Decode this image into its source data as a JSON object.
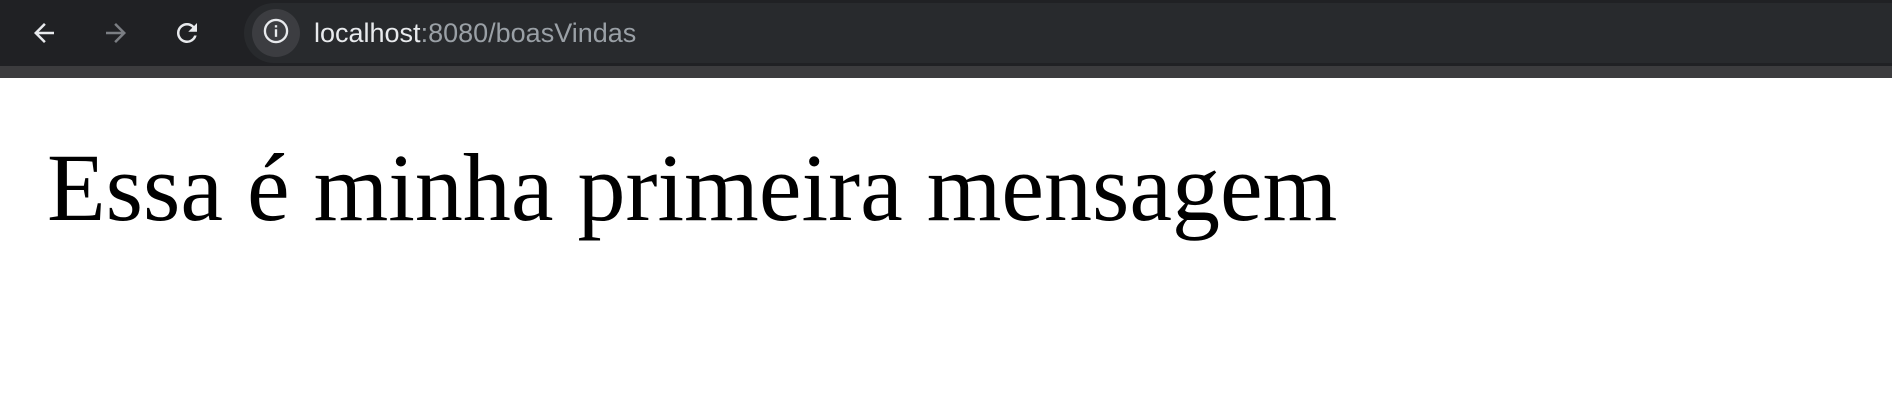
{
  "browser": {
    "address_bar": {
      "host": "localhost",
      "rest": ":8080/boasVindas"
    },
    "icons": {
      "back": "arrow-left-icon",
      "forward": "arrow-right-icon",
      "reload": "reload-icon",
      "site_info": "info-icon"
    },
    "forward_enabled": false
  },
  "page": {
    "heading": "Essa é minha primeira mensagem"
  },
  "colors": {
    "toolbar_bg": "#202124",
    "omnibox_bg": "#282a2d",
    "url_host": "#e8eaed",
    "url_rest": "#9aa0a6",
    "page_bg": "#ffffff",
    "heading_text": "#000000"
  }
}
